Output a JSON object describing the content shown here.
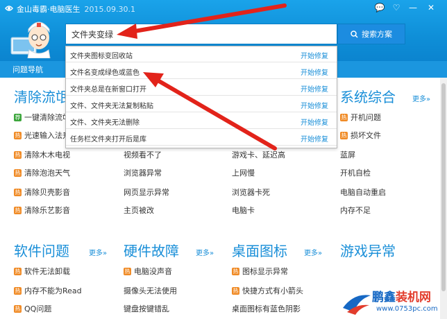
{
  "window": {
    "title": "金山毒霸·电脑医生",
    "version": "2015.09.30.1",
    "controls": [
      "💬",
      "♡",
      "—",
      "✕"
    ]
  },
  "search": {
    "value": "文件夹变绿",
    "button_label": "搜索方案"
  },
  "nav": {
    "label": "问题导航"
  },
  "dropdown": {
    "items": [
      {
        "text": "文件夹图标变回收站",
        "action": "开始修复"
      },
      {
        "text": "文件名变成绿色或蓝色",
        "action": "开始修复"
      },
      {
        "text": "文件夹总是在新窗口打开",
        "action": "开始修复"
      },
      {
        "text": "文件、文件夹无法复制粘贴",
        "action": "开始修复"
      },
      {
        "text": "文件、文件夹无法删除",
        "action": "开始修复"
      },
      {
        "text": "任务栏文件夹打开后是库",
        "action": "开始修复"
      }
    ]
  },
  "sections": {
    "clean": {
      "title": "清除流氓",
      "rows": [
        {
          "tag": "new",
          "text": "一键清除流氓"
        },
        {
          "tag": "hot",
          "text": "光速输入法升级"
        },
        {
          "tag": "hot",
          "text": "清除木木电视"
        },
        {
          "tag": "hot",
          "text": "清除泡泡天气"
        },
        {
          "tag": "hot",
          "text": "清除贝壳影音"
        },
        {
          "tag": "hot",
          "text": "清除乐艺影音"
        }
      ]
    },
    "col2": {
      "rows": [
        {
          "text": "视频看不了"
        },
        {
          "text": "浏览器异常"
        },
        {
          "text": "网页显示异常"
        },
        {
          "text": "主页被改"
        }
      ]
    },
    "col3": {
      "rows": [
        {
          "text": "游戏卡、延迟高"
        },
        {
          "text": "上网慢"
        },
        {
          "text": "浏览器卡死"
        },
        {
          "text": "电脑卡"
        }
      ]
    },
    "system": {
      "title": "系统综合",
      "more": "更多»",
      "rows": [
        {
          "tag": "hot",
          "text": "开机问题"
        },
        {
          "tag": "hot",
          "text": "损坏文件"
        },
        {
          "text": "蓝屏"
        },
        {
          "text": "开机自检"
        },
        {
          "text": "电脑自动重启"
        },
        {
          "text": "内存不足"
        }
      ]
    },
    "software": {
      "title": "软件问题",
      "more": "更多»",
      "rows": [
        {
          "tag": "hot",
          "text": "软件无法卸载"
        },
        {
          "tag": "hot",
          "text": "内存不能为Read"
        },
        {
          "tag": "hot",
          "text": "QQ问题"
        }
      ]
    },
    "hardware": {
      "title": "硬件故障",
      "more": "更多»",
      "rows": [
        {
          "tag": "hot",
          "text": "电脑没声音"
        },
        {
          "text": "摄像头无法使用"
        },
        {
          "text": "键盘按键错乱"
        }
      ]
    },
    "desktop": {
      "title": "桌面图标",
      "more": "更多»",
      "rows": [
        {
          "tag": "hot",
          "text": "图标显示异常"
        },
        {
          "tag": "hot",
          "text": "快捷方式有小箭头"
        },
        {
          "text": "桌面图标有蓝色阴影"
        }
      ]
    },
    "game": {
      "title": "游戏异常",
      "rows": []
    }
  },
  "tag_glyphs": {
    "hot": "热",
    "new": "荐"
  },
  "colors": {
    "header_blue": "#1aa3ea",
    "accent_blue": "#1a8fd8",
    "hot_tag": "#f08a24",
    "new_tag": "#3aa53a",
    "arrow_red": "#e2231a"
  },
  "watermark": {
    "brand_main": "鹏鑫",
    "brand_accent": "装机网",
    "url": "www.0753pc.com"
  }
}
